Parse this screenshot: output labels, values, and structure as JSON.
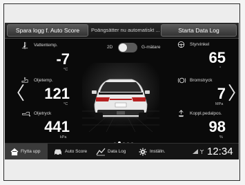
{
  "top_bar": {
    "save_button": "Spara logg f. Auto Score",
    "points_text": "Poängsätter nu automatiskt ...",
    "start_button": "Starta Data Log"
  },
  "toggle": {
    "left_label": "2D",
    "right_label": "G-mätare",
    "on": false
  },
  "gauges_left": [
    {
      "label": "Vattentemp.",
      "value": "-7",
      "unit": "°C",
      "icon": "coolant-temp-icon"
    },
    {
      "label": "Oljetemp.",
      "value": "121",
      "unit": "°C",
      "icon": "oil-temp-icon"
    },
    {
      "label": "Oljetryck",
      "value": "441",
      "unit": "kPa",
      "icon": "oil-pressure-icon"
    }
  ],
  "gauges_right": [
    {
      "label": "Styrvinkel",
      "value": "65",
      "unit": "°",
      "icon": "steering-wheel-icon"
    },
    {
      "label": "Bromstryck",
      "value": "7",
      "unit": "MPa",
      "icon": "brake-icon"
    },
    {
      "label": "Koppl.pedalpos.",
      "value": "98",
      "unit": "%",
      "icon": "clutch-pedal-icon"
    }
  ],
  "pager": {
    "count": 5,
    "active": 1
  },
  "bottom_nav": [
    {
      "label": "Flytta upp",
      "icon": "home-icon",
      "active": true
    },
    {
      "label": "Auto Score",
      "icon": "car-icon",
      "active": false
    },
    {
      "label": "Data Log",
      "icon": "data-log-icon",
      "active": false
    },
    {
      "label": "Inställn.",
      "icon": "gear-icon",
      "active": false
    }
  ],
  "status": {
    "clock": "12:34",
    "icons": [
      "signal-icon",
      "antenna-icon"
    ]
  },
  "arrows": {
    "left": "〈",
    "right": "〉"
  }
}
